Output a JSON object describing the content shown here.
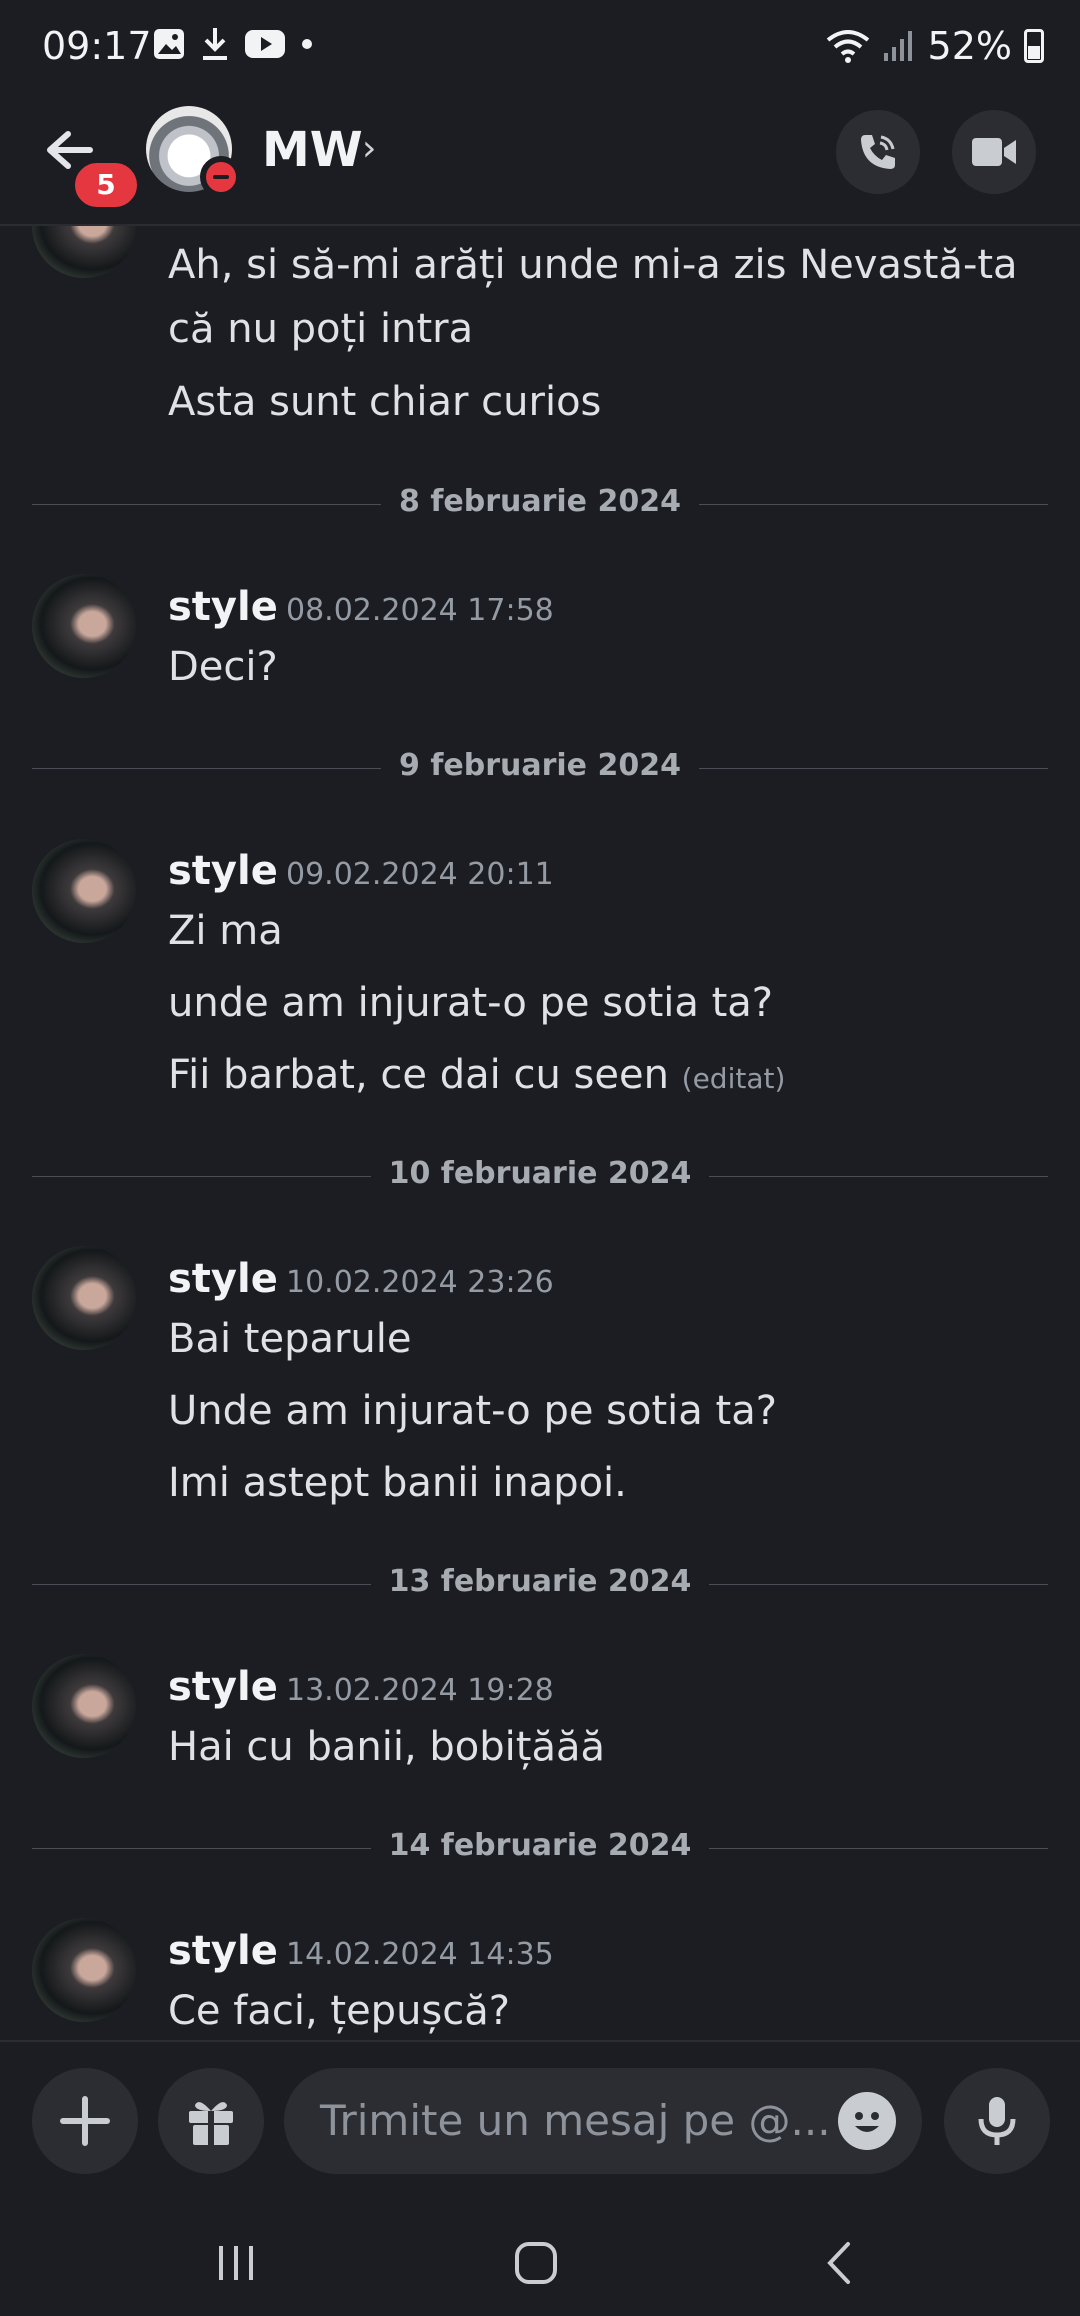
{
  "status_bar": {
    "time": "09:17",
    "battery_text": "52%",
    "icons": [
      "gallery-icon",
      "download-icon",
      "youtube-icon",
      "dot-icon",
      "wifi-icon",
      "signal-icon",
      "battery-icon"
    ]
  },
  "header": {
    "unread_badge": "5",
    "name": "MW",
    "chevron": "›",
    "icons": [
      "back-arrow-icon",
      "call-icon",
      "video-icon"
    ]
  },
  "messages": {
    "top_continuation": [
      "Ah, si să-mi arăți unde mi-a zis Nevastă-ta",
      "că nu poți intra",
      "Asta sunt chiar curios"
    ],
    "groups": [
      {
        "date": "8 februarie 2024",
        "author": "style",
        "timestamp": "08.02.2024 17:58",
        "lines": [
          "Deci?"
        ]
      },
      {
        "date": "9 februarie 2024",
        "author": "style",
        "timestamp": "09.02.2024 20:11",
        "lines": [
          "Zi ma",
          "unde am injurat-o pe sotia ta?",
          "Fii barbat, ce dai cu seen"
        ],
        "edited": "(editat)"
      },
      {
        "date": "10 februarie 2024",
        "author": "style",
        "timestamp": "10.02.2024 23:26",
        "lines": [
          "Bai teparule",
          "Unde am injurat-o pe sotia ta?",
          "Imi astept banii inapoi."
        ]
      },
      {
        "date": "13 februarie 2024",
        "author": "style",
        "timestamp": "13.02.2024 19:28",
        "lines": [
          "Hai cu banii, bobițăăă"
        ]
      },
      {
        "date": "14 februarie 2024",
        "author": "style",
        "timestamp": "14.02.2024 14:35",
        "lines": [
          "Ce faci, țepușcă?"
        ]
      }
    ]
  },
  "composer": {
    "placeholder": "Trimite un mesaj pe @...",
    "icons": [
      "plus-icon",
      "gift-icon",
      "emoji-icon",
      "microphone-icon"
    ]
  },
  "navbar": {
    "icons": [
      "recent-apps-icon",
      "home-icon",
      "back-icon"
    ]
  },
  "colors": {
    "background": "#1c1d22",
    "surface": "#2b2d33",
    "badge_red": "#e5373f",
    "text": "#dfe1e5",
    "muted": "#949ba4"
  }
}
